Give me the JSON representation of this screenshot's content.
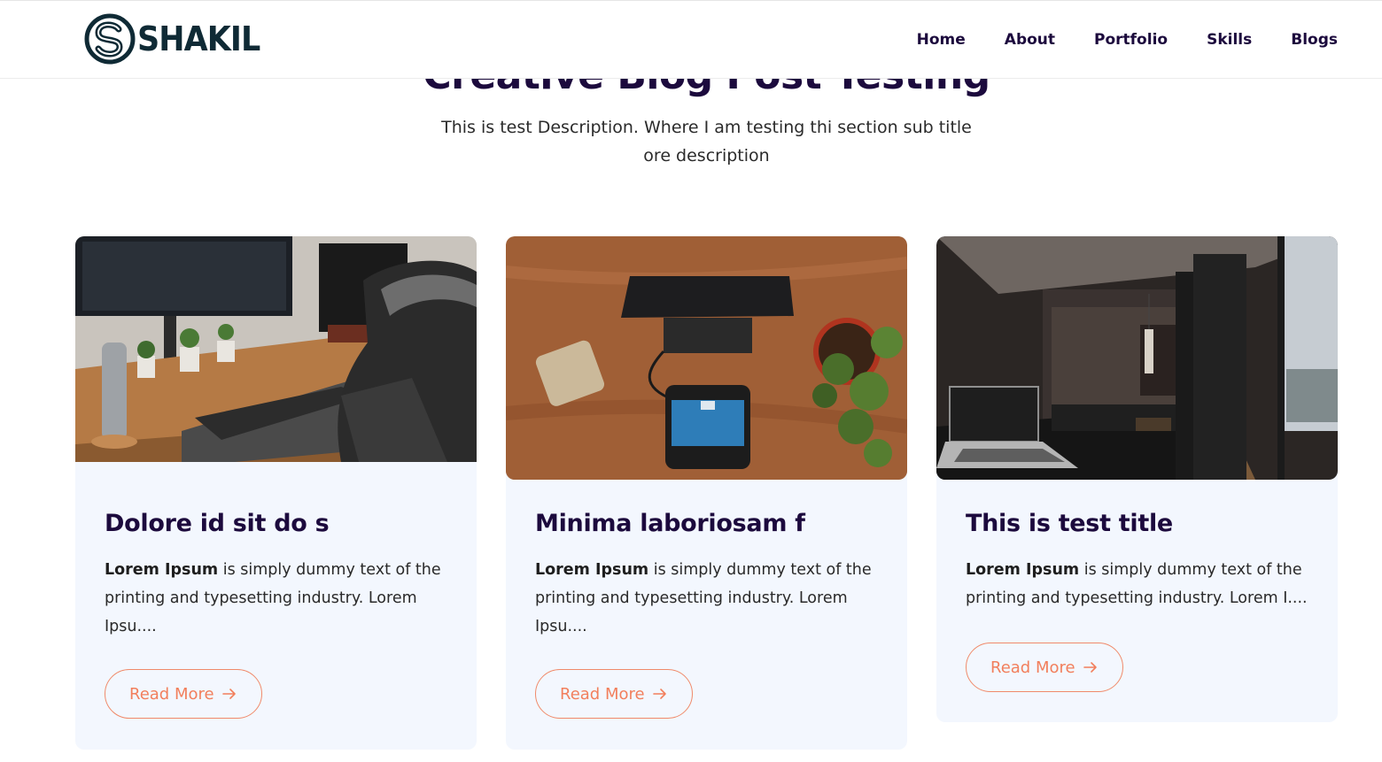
{
  "header": {
    "logo_text": "SHAKIL",
    "nav": [
      "Home",
      "About",
      "Portfolio",
      "Skills",
      "Blogs"
    ]
  },
  "section": {
    "title": "Creative Blog Post Testing",
    "description": "This is test Description. Where I am testing thi section sub title ore description"
  },
  "cards": [
    {
      "image": "desk-setup-photo",
      "title": "Dolore id sit do s",
      "excerpt_bold": "Lorem Ipsum",
      "excerpt_rest": " is simply dummy text of the printing and typesetting industry. Lorem Ipsu....",
      "button": "Read More"
    },
    {
      "image": "payment-terminal-photo",
      "title": "Minima laboriosam f",
      "excerpt_bold": "Lorem Ipsum",
      "excerpt_rest": " is simply dummy text of the printing and typesetting industry. Lorem Ipsu....",
      "button": "Read More"
    },
    {
      "image": "dark-interior-photo",
      "title": "This is test title",
      "excerpt_bold": "Lorem Ipsum",
      "excerpt_rest": " is simply dummy text of the printing and typesetting industry. Lorem I....",
      "button": "Read More"
    }
  ],
  "colors": {
    "heading": "#1c0a3d",
    "accent": "#f27f5c",
    "card_bg": "#f3f7fe"
  }
}
